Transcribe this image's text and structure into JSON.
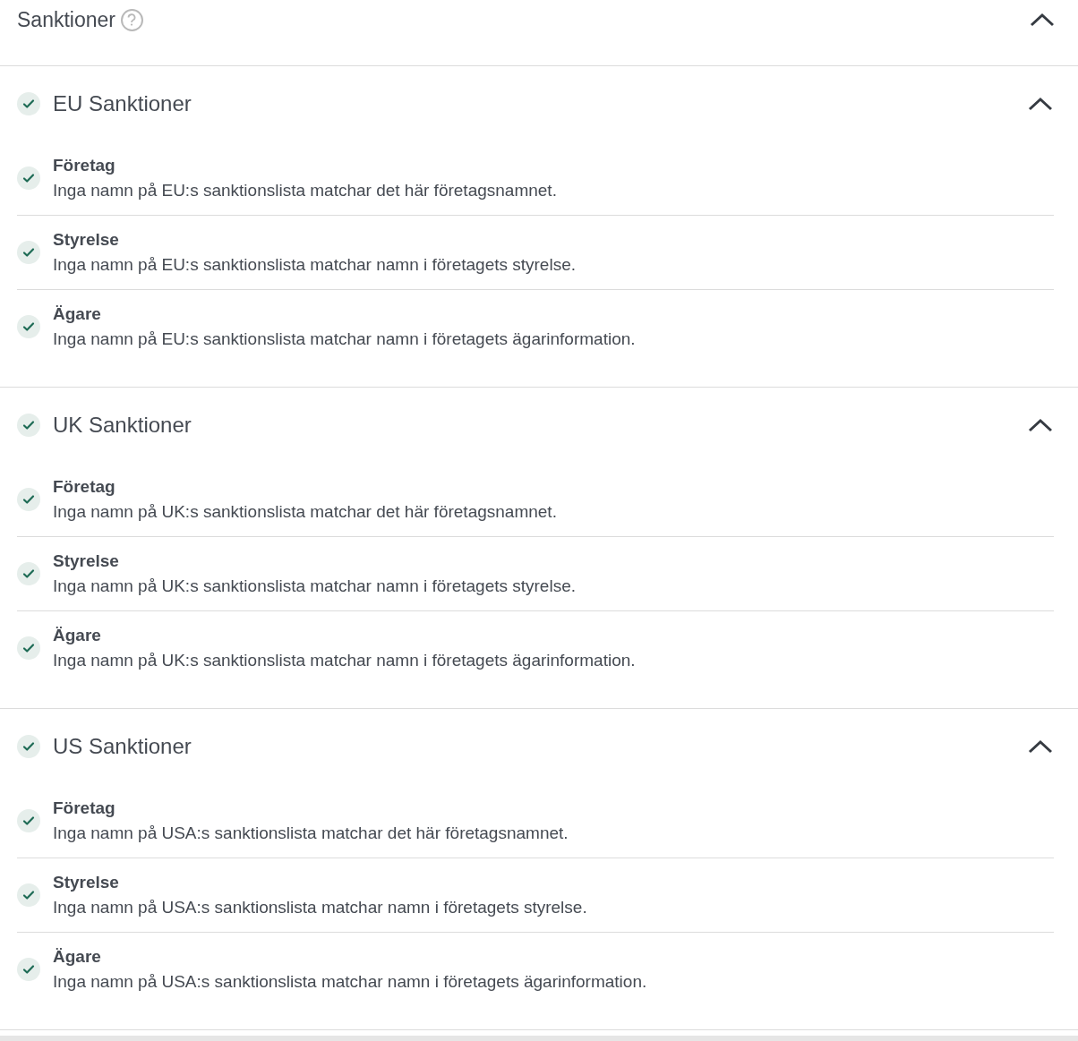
{
  "header": {
    "title": "Sanktioner",
    "expanded": true
  },
  "sections": [
    {
      "title": "EU Sanktioner",
      "passed": true,
      "expanded": true,
      "items": [
        {
          "title": "Företag",
          "description": "Inga namn på EU:s sanktionslista matchar det här företagsnamnet.",
          "passed": true
        },
        {
          "title": "Styrelse",
          "description": "Inga namn på EU:s sanktionslista matchar namn i företagets styrelse.",
          "passed": true
        },
        {
          "title": "Ägare",
          "description": "Inga namn på EU:s sanktionslista matchar namn i företagets ägarinformation.",
          "passed": true
        }
      ]
    },
    {
      "title": "UK Sanktioner",
      "passed": true,
      "expanded": true,
      "items": [
        {
          "title": "Företag",
          "description": "Inga namn på UK:s sanktionslista matchar det här företagsnamnet.",
          "passed": true
        },
        {
          "title": "Styrelse",
          "description": "Inga namn på UK:s sanktionslista matchar namn i företagets styrelse.",
          "passed": true
        },
        {
          "title": "Ägare",
          "description": "Inga namn på UK:s sanktionslista matchar namn i företagets ägarinformation.",
          "passed": true
        }
      ]
    },
    {
      "title": "US Sanktioner",
      "passed": true,
      "expanded": true,
      "items": [
        {
          "title": "Företag",
          "description": "Inga namn på USA:s sanktionslista matchar det här företagsnamnet.",
          "passed": true
        },
        {
          "title": "Styrelse",
          "description": "Inga namn på USA:s sanktionslista matchar namn i företagets styrelse.",
          "passed": true
        },
        {
          "title": "Ägare",
          "description": "Inga namn på USA:s sanktionslista matchar namn i företagets ägarinformation.",
          "passed": true
        }
      ]
    }
  ]
}
